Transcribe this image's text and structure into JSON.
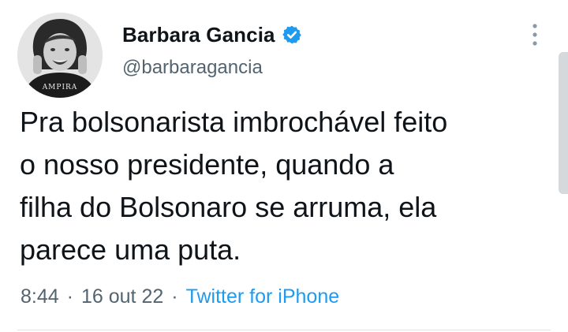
{
  "author": {
    "display_name": "Barbara Gancia",
    "handle": "@barbaragancia",
    "avatar_shirt_text": "AMPIRA"
  },
  "icons": {
    "verified": "verified-badge-icon",
    "more": "more-vertical-icon"
  },
  "tweet": {
    "text": "Pra bolsonarista imbrochável feito\no nosso presidente, quando a\nfilha do Bolsonaro se arruma, ela\nparece uma puta."
  },
  "meta": {
    "time": "8:44",
    "separator": "·",
    "date": "16 out 22",
    "source": "Twitter for iPhone"
  },
  "colors": {
    "text": "#0f1419",
    "secondary": "#536471",
    "link": "#1d9bf0",
    "verified": "#1d9bf0"
  }
}
